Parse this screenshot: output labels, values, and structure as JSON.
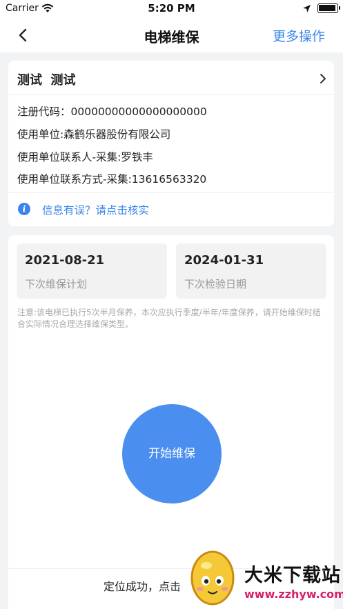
{
  "status_bar": {
    "carrier": "Carrier",
    "time": "5:20 PM"
  },
  "nav": {
    "title": "电梯维保",
    "more_action": "更多操作"
  },
  "elevator_card": {
    "name": "测试  测试",
    "registration_code": "注册代码：00000000000000000000",
    "user_unit": "使用单位:森鹤乐器股份有限公司",
    "contact_person": "使用单位联系人-采集:罗铁丰",
    "contact_phone": "使用单位联系方式-采集:13616563320",
    "info_error_link": "信息有误？请点击核实"
  },
  "schedule": {
    "next_maintenance_date": "2021-08-21",
    "next_maintenance_label": "下次维保计划",
    "next_inspection_date": "2024-01-31",
    "next_inspection_label": "下次检验日期",
    "note": "注意:该电梯已执行5次半月保养，本次应执行季度/半年/年度保养，请开始维保时结合实际情况合理选择维保类型。"
  },
  "actions": {
    "start_button": "开始维保",
    "location_status": "定位成功，点击"
  },
  "watermark": {
    "site_name": "大米下载站",
    "url": "www.zzhyw.com"
  },
  "colors": {
    "accent": "#3a86e8",
    "button": "#4a8ef0",
    "background": "#f2f3f5"
  }
}
